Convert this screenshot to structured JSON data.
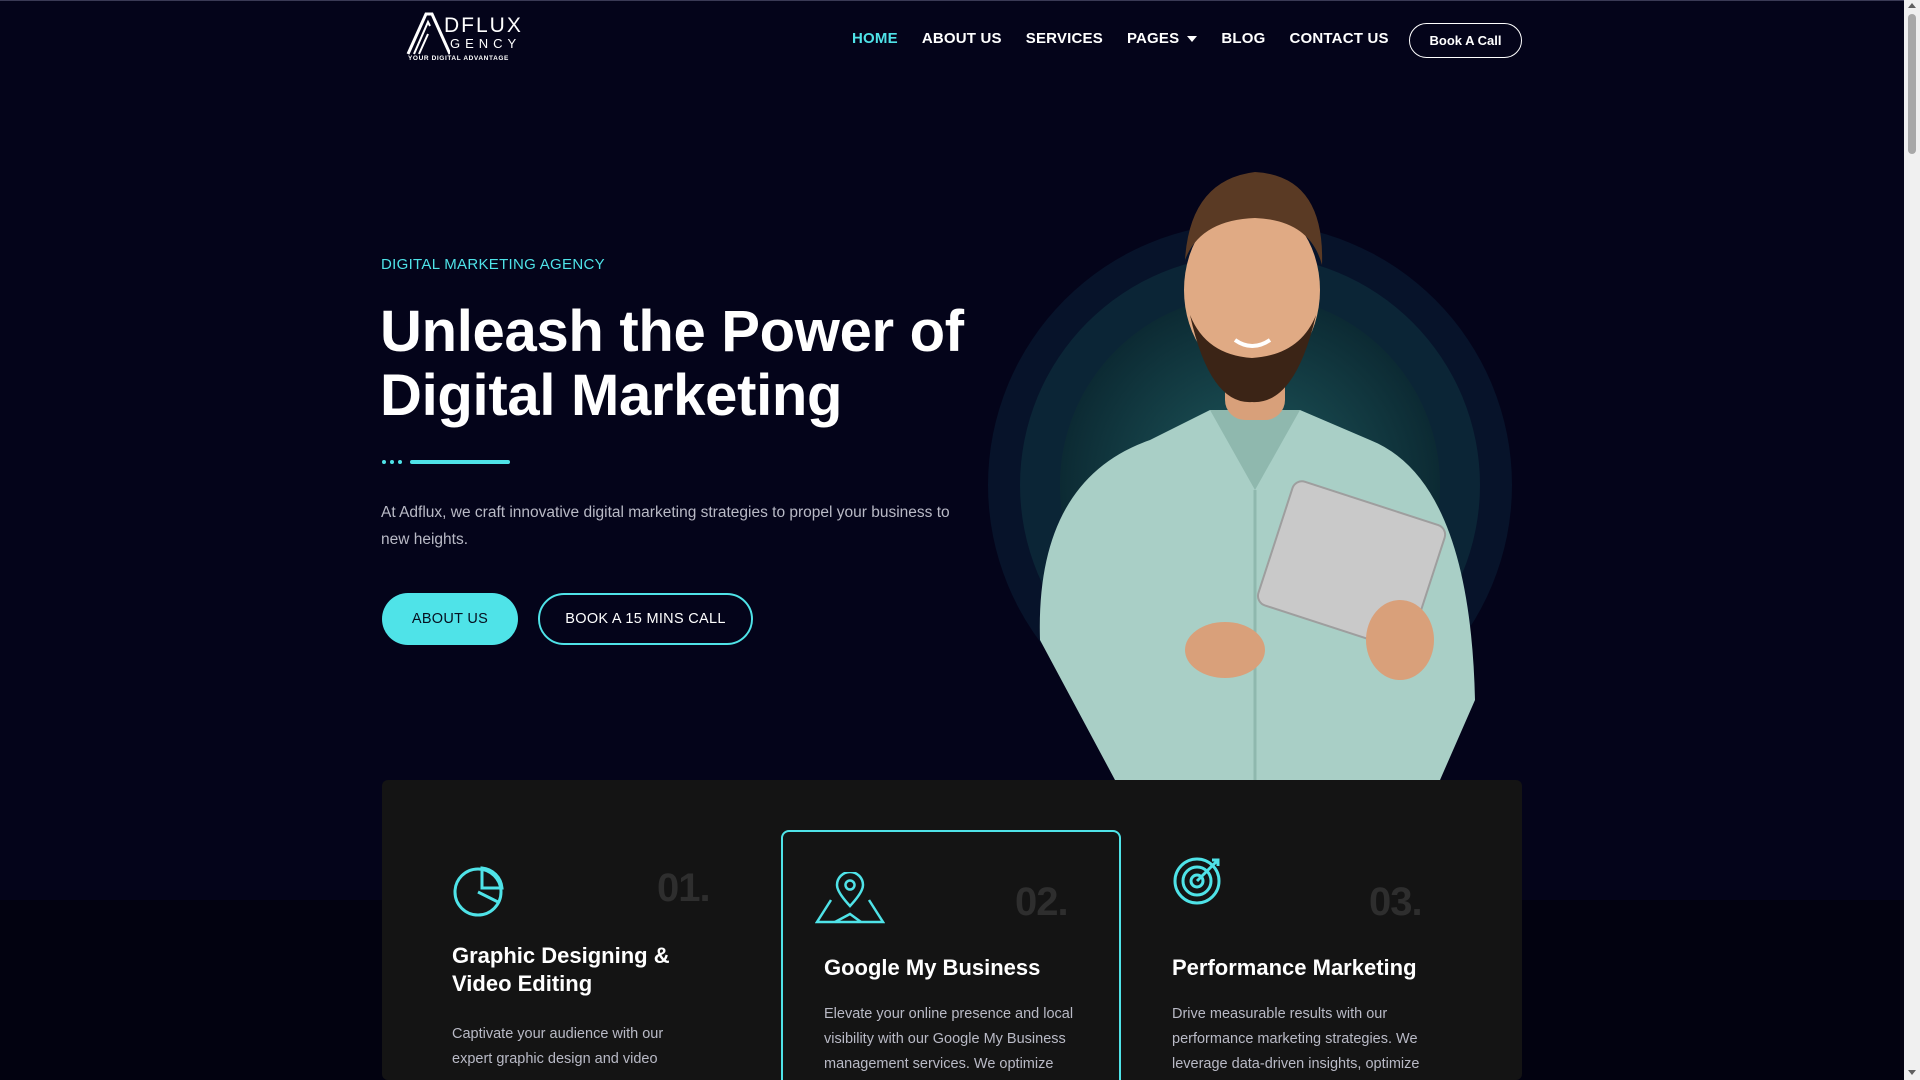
{
  "brand": {
    "name": "DFLUX",
    "sub": "GENCY",
    "tagline": "YOUR DIGITAL ADVANTAGE"
  },
  "nav": {
    "items": [
      {
        "label": "HOME",
        "active": true
      },
      {
        "label": "ABOUT US"
      },
      {
        "label": "SERVICES"
      },
      {
        "label": "PAGES",
        "dropdown": true
      },
      {
        "label": "BLOG"
      },
      {
        "label": "CONTACT US"
      }
    ],
    "cta": "Book A Call"
  },
  "hero": {
    "eyebrow": "DIGITAL MARKETING AGENCY",
    "title_line1": "Unleash the Power of",
    "title_line2": "Digital Marketing",
    "description": "At Adflux, we craft innovative digital marketing strategies to propel your business to new heights.",
    "primary_button": "ABOUT US",
    "secondary_button": "BOOK A 15 MINS CALL"
  },
  "services": [
    {
      "number": "01.",
      "icon": "pie-chart-icon",
      "title_line1": "Graphic Designing &",
      "title_line2": "Video Editing",
      "description": "Captivate your audience with our expert graphic design and video"
    },
    {
      "number": "02.",
      "icon": "map-pin-icon",
      "title_line1": "Google My Business",
      "title_line2": "",
      "description": "Elevate your online presence and local visibility with our Google My Business management services. We optimize"
    },
    {
      "number": "03.",
      "icon": "target-icon",
      "title_line1": "Performance Marketing",
      "title_line2": "",
      "description": "Drive measurable results with our performance marketing strategies. We leverage data-driven insights, optimize"
    }
  ],
  "colors": {
    "accent": "#4fe3e8",
    "background": "#04041a",
    "panel": "#141414"
  }
}
